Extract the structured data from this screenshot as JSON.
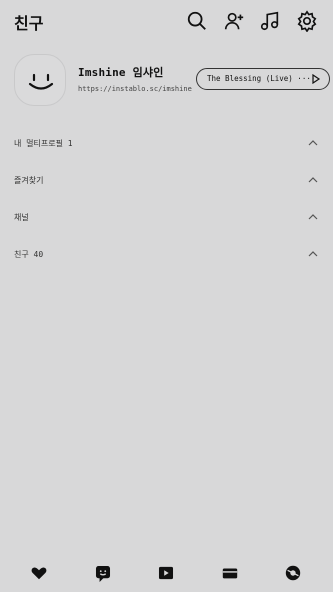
{
  "header": {
    "title": "친구",
    "icons": [
      "search-icon",
      "add-friend-icon",
      "music-icon",
      "settings-icon"
    ]
  },
  "profile": {
    "name": "Imshine 임샤인",
    "url": "https://instablo.sc/imshine",
    "music": "The Blessing (Live) ····"
  },
  "sections": [
    {
      "label": "내 멀티프로필 1"
    },
    {
      "label": "즐겨찾기"
    },
    {
      "label": "채널"
    },
    {
      "label": "친구 40"
    }
  ],
  "tabbar": {
    "tabs": [
      "friends-tab-icon",
      "chats-tab-icon",
      "view-tab-icon",
      "shopping-tab-icon",
      "more-tab-icon"
    ]
  },
  "colors": {
    "background": "#d8d8d9",
    "ink": "#111111"
  }
}
